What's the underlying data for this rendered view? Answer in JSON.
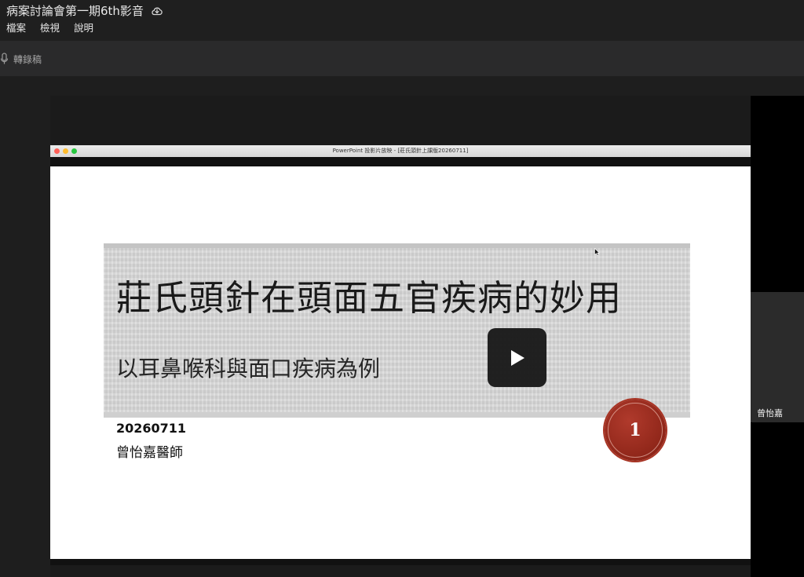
{
  "header": {
    "document_title": "病案討論會第一期6th影音",
    "menu": [
      {
        "label": "檔案"
      },
      {
        "label": "檢視"
      },
      {
        "label": "說明"
      }
    ]
  },
  "toolbar": {
    "transcript_label": "轉錄稿"
  },
  "video": {
    "ppt_window_title": "PowerPoint 投影片放映 - [莊氏頭針上課版20260711]",
    "slide": {
      "title": "莊氏頭針在頭面五官疾病的妙用",
      "subtitle": "以耳鼻喉科與面口疾病為例",
      "date": "20260711",
      "presenter": "曾怡嘉醫師",
      "slide_number": "1"
    },
    "play_icon": "play-icon"
  },
  "participants": [
    {
      "name": "曾怡嘉"
    }
  ],
  "colors": {
    "badge_red": "#9c2c1e",
    "app_bg": "#1e1e1e",
    "toolbar_bg": "#2a2a2b"
  }
}
